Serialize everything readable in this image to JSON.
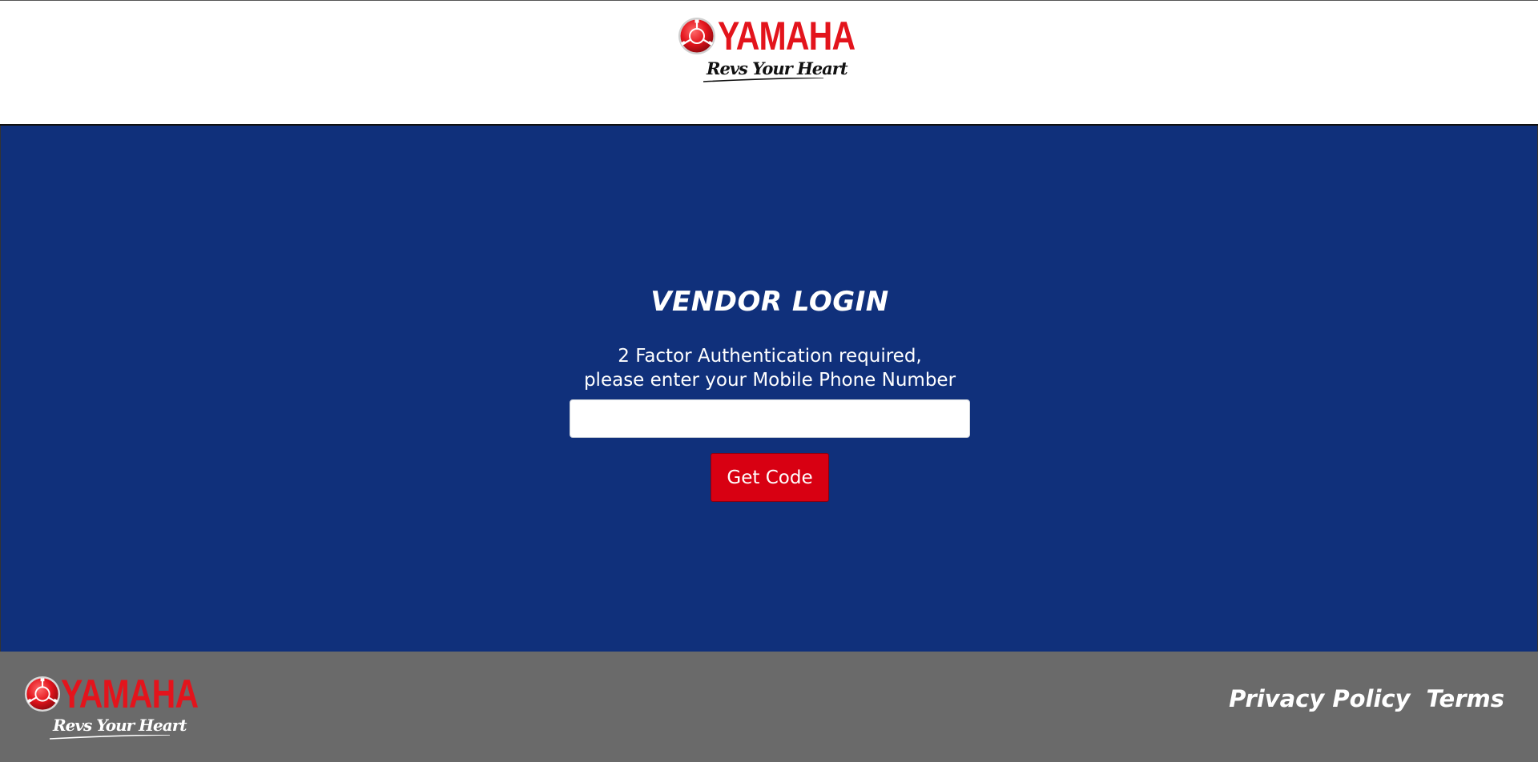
{
  "header": {
    "logo": {
      "wordmark": "YAMAHA",
      "tagline": "Revs Your Heart",
      "icon": "yamaha-tuning-fork-emblem-icon"
    }
  },
  "main": {
    "title": "VENDOR LOGIN",
    "instructions": {
      "line1": "2 Factor Authentication required,",
      "line2": "please enter your Mobile Phone Number"
    },
    "phone_input": {
      "value": "",
      "placeholder": ""
    },
    "get_code_label": "Get Code"
  },
  "footer": {
    "logo": {
      "wordmark": "YAMAHA",
      "tagline": "Revs Your Heart",
      "icon": "yamaha-tuning-fork-emblem-icon"
    },
    "links": {
      "privacy": "Privacy Policy",
      "terms": "Terms"
    }
  },
  "colors": {
    "brand_red": "#e3141c",
    "main_background": "#10307b",
    "button_red": "#d80012",
    "footer_background": "#6a6a6a"
  }
}
